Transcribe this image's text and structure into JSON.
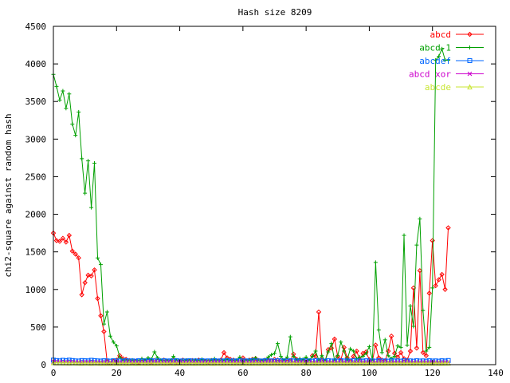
{
  "chart_data": {
    "type": "line",
    "title": "Hash size 8209",
    "xlabel": "",
    "ylabel": "chi2-square against random hash",
    "xlim": [
      0,
      140
    ],
    "ylim": [
      0,
      4500
    ],
    "xticks": [
      0,
      20,
      40,
      60,
      80,
      100,
      120,
      140
    ],
    "yticks": [
      0,
      500,
      1000,
      1500,
      2000,
      2500,
      3000,
      3500,
      4000,
      4500
    ],
    "grid": false,
    "legend_position": "top-right",
    "series": [
      {
        "name": "abcd",
        "color": "#ff0000",
        "marker": "diamond",
        "x": [
          0,
          1,
          2,
          3,
          4,
          5,
          6,
          7,
          8,
          9,
          10,
          11,
          12,
          13,
          14,
          15,
          16,
          17,
          18,
          19,
          20,
          21,
          22,
          23,
          24,
          25,
          26,
          27,
          28,
          29,
          30,
          31,
          32,
          33,
          34,
          35,
          36,
          37,
          38,
          39,
          40,
          41,
          42,
          43,
          44,
          45,
          46,
          47,
          48,
          49,
          50,
          51,
          52,
          53,
          54,
          55,
          56,
          57,
          58,
          59,
          60,
          61,
          62,
          63,
          64,
          65,
          66,
          67,
          68,
          69,
          70,
          71,
          72,
          73,
          74,
          75,
          76,
          77,
          78,
          79,
          80,
          81,
          82,
          83,
          84,
          85,
          86,
          87,
          88,
          89,
          90,
          91,
          92,
          93,
          94,
          95,
          96,
          97,
          98,
          99,
          100,
          101,
          102,
          103,
          104,
          105,
          106,
          107,
          108,
          109,
          110,
          111,
          112,
          113,
          114,
          115,
          116,
          117,
          118,
          119,
          120,
          121,
          122,
          123,
          124,
          125
        ],
        "y": [
          1750,
          1650,
          1640,
          1680,
          1630,
          1720,
          1510,
          1470,
          1420,
          930,
          1090,
          1190,
          1180,
          1260,
          880,
          650,
          440,
          40,
          20,
          45,
          60,
          120,
          80,
          70,
          55,
          40,
          45,
          35,
          60,
          50,
          45,
          40,
          55,
          50,
          45,
          60,
          45,
          40,
          55,
          40,
          45,
          60,
          50,
          45,
          55,
          45,
          60,
          50,
          45,
          40,
          55,
          45,
          50,
          60,
          160,
          90,
          70,
          60,
          45,
          55,
          90,
          50,
          60,
          70,
          80,
          55,
          45,
          60,
          65,
          50,
          70,
          60,
          55,
          45,
          60,
          50,
          140,
          70,
          55,
          45,
          60,
          50,
          120,
          110,
          700,
          60,
          45,
          200,
          220,
          340,
          110,
          60,
          230,
          90,
          50,
          110,
          180,
          60,
          150,
          170,
          65,
          55,
          260,
          90,
          60,
          50,
          180,
          380,
          150,
          100,
          160,
          80,
          60,
          180,
          1020,
          220,
          1250,
          160,
          120,
          950,
          1650,
          1050,
          1130,
          1200,
          1000,
          1820
        ]
      },
      {
        "name": "abcd-1",
        "color": "#00a000",
        "marker": "plus",
        "x": [
          0,
          1,
          2,
          3,
          4,
          5,
          6,
          7,
          8,
          9,
          10,
          11,
          12,
          13,
          14,
          15,
          16,
          17,
          18,
          19,
          20,
          21,
          22,
          23,
          24,
          25,
          26,
          27,
          28,
          29,
          30,
          31,
          32,
          33,
          34,
          35,
          36,
          37,
          38,
          39,
          40,
          41,
          42,
          43,
          44,
          45,
          46,
          47,
          48,
          49,
          50,
          51,
          52,
          53,
          54,
          55,
          56,
          57,
          58,
          59,
          60,
          61,
          62,
          63,
          64,
          65,
          66,
          67,
          68,
          69,
          70,
          71,
          72,
          73,
          74,
          75,
          76,
          77,
          78,
          79,
          80,
          81,
          82,
          83,
          84,
          85,
          86,
          87,
          88,
          89,
          90,
          91,
          92,
          93,
          94,
          95,
          96,
          97,
          98,
          99,
          100,
          101,
          102,
          103,
          104,
          105,
          106,
          107,
          108,
          109,
          110,
          111,
          112,
          113,
          114,
          115,
          116,
          117,
          118,
          119,
          120,
          121,
          122,
          123,
          124,
          125
        ],
        "y": [
          3860,
          3700,
          3520,
          3640,
          3410,
          3600,
          3200,
          3050,
          3360,
          2740,
          2280,
          2710,
          2090,
          2680,
          1420,
          1330,
          540,
          700,
          380,
          300,
          250,
          100,
          60,
          50,
          45,
          60,
          40,
          55,
          80,
          60,
          90,
          70,
          170,
          90,
          60,
          45,
          55,
          50,
          110,
          60,
          45,
          55,
          60,
          50,
          45,
          60,
          55,
          70,
          50,
          45,
          60,
          80,
          50,
          45,
          60,
          70,
          55,
          50,
          60,
          100,
          45,
          55,
          60,
          70,
          90,
          50,
          55,
          60,
          100,
          130,
          150,
          280,
          110,
          60,
          100,
          370,
          110,
          60,
          80,
          70,
          100,
          60,
          110,
          180,
          60,
          120,
          50,
          170,
          280,
          60,
          120,
          300,
          180,
          60,
          210,
          180,
          80,
          100,
          110,
          150,
          240,
          60,
          1360,
          460,
          160,
          330,
          120,
          80,
          110,
          250,
          230,
          1720,
          260,
          780,
          510,
          1590,
          1940,
          720,
          180,
          230,
          1020,
          4050,
          4100,
          4200,
          4050,
          4050
        ]
      },
      {
        "name": "abcdef",
        "color": "#0066ff",
        "marker": "square",
        "x": [
          0,
          1,
          2,
          3,
          4,
          5,
          6,
          7,
          8,
          9,
          10,
          11,
          12,
          13,
          14,
          15,
          16,
          17,
          18,
          19,
          20,
          21,
          22,
          23,
          24,
          25,
          26,
          27,
          28,
          29,
          30,
          31,
          32,
          33,
          34,
          35,
          36,
          37,
          38,
          39,
          40,
          41,
          42,
          43,
          44,
          45,
          46,
          47,
          48,
          49,
          50,
          51,
          52,
          53,
          54,
          55,
          56,
          57,
          58,
          59,
          60,
          61,
          62,
          63,
          64,
          65,
          66,
          67,
          68,
          69,
          70,
          71,
          72,
          73,
          74,
          75,
          76,
          77,
          78,
          79,
          80,
          81,
          82,
          83,
          84,
          85,
          86,
          87,
          88,
          89,
          90,
          91,
          92,
          93,
          94,
          95,
          96,
          97,
          98,
          99,
          100,
          101,
          102,
          103,
          104,
          105,
          106,
          107,
          108,
          109,
          110,
          111,
          112,
          113,
          114,
          115,
          116,
          117,
          118,
          119,
          120,
          121,
          122,
          123,
          124,
          125
        ],
        "y": [
          60,
          55,
          50,
          58,
          52,
          60,
          55,
          50,
          48,
          55,
          52,
          50,
          58,
          54,
          50,
          48,
          52,
          50,
          46,
          52,
          48,
          50,
          46,
          52,
          48,
          50,
          46,
          52,
          48,
          50,
          46,
          52,
          48,
          50,
          46,
          52,
          48,
          50,
          46,
          52,
          48,
          50,
          46,
          52,
          48,
          50,
          46,
          52,
          48,
          50,
          46,
          52,
          48,
          50,
          46,
          52,
          48,
          50,
          46,
          52,
          48,
          50,
          46,
          52,
          48,
          50,
          46,
          52,
          48,
          50,
          46,
          52,
          48,
          50,
          46,
          52,
          48,
          50,
          46,
          52,
          48,
          50,
          46,
          52,
          48,
          50,
          46,
          52,
          48,
          50,
          46,
          52,
          48,
          50,
          46,
          52,
          48,
          50,
          46,
          52,
          48,
          50,
          46,
          52,
          48,
          50,
          46,
          52,
          48,
          50,
          46,
          52,
          48,
          50,
          46,
          52,
          48,
          50,
          46,
          52,
          48,
          50,
          46,
          52,
          48,
          55
        ]
      },
      {
        "name": "abcd xor",
        "color": "#cc00cc",
        "marker": "x",
        "x": [
          0,
          1,
          2,
          3,
          4,
          5,
          6,
          7,
          8,
          9,
          10,
          11,
          12,
          13,
          14,
          15,
          16,
          17,
          18,
          19,
          20,
          21,
          22,
          23,
          24,
          25,
          26,
          27,
          28,
          29,
          30,
          31,
          32,
          33,
          34,
          35,
          36,
          37,
          38,
          39,
          40,
          41,
          42,
          43,
          44,
          45,
          46,
          47,
          48,
          49,
          50,
          51,
          52,
          53,
          54,
          55,
          56,
          57,
          58,
          59,
          60,
          61,
          62,
          63,
          64,
          65,
          66,
          67,
          68,
          69,
          70,
          71,
          72,
          73,
          74,
          75,
          76,
          77,
          78,
          79,
          80,
          81,
          82,
          83,
          84,
          85,
          86,
          87,
          88,
          89,
          90,
          91,
          92,
          93,
          94,
          95,
          96,
          97,
          98,
          99,
          100,
          101,
          102,
          103,
          104,
          105,
          106,
          107,
          108,
          109,
          110,
          111,
          112,
          113,
          114,
          115,
          116,
          117,
          118,
          119,
          120,
          121,
          122,
          123,
          124,
          125
        ],
        "y": [
          40,
          35,
          38,
          34,
          36,
          33,
          35,
          32,
          34,
          30,
          33,
          31,
          34,
          30,
          32,
          30,
          28,
          32,
          30,
          28,
          31,
          29,
          30,
          28,
          31,
          29,
          30,
          28,
          31,
          29,
          30,
          28,
          31,
          29,
          30,
          28,
          31,
          29,
          30,
          28,
          31,
          29,
          30,
          28,
          31,
          29,
          30,
          28,
          31,
          29,
          30,
          28,
          31,
          29,
          30,
          28,
          31,
          29,
          30,
          28,
          31,
          29,
          30,
          28,
          31,
          29,
          30,
          28,
          31,
          29,
          30,
          28,
          31,
          29,
          30,
          28,
          31,
          29,
          30,
          28,
          31,
          29,
          30,
          28,
          31,
          29,
          30,
          28,
          31,
          29,
          30,
          28,
          31,
          29,
          30,
          28,
          31,
          29,
          30,
          28,
          31,
          29,
          30,
          28,
          31,
          29,
          30,
          28,
          31,
          29,
          30,
          28,
          31,
          29,
          30,
          28,
          31,
          29,
          30,
          28,
          31,
          29,
          30,
          28,
          31,
          30
        ]
      },
      {
        "name": "abcde",
        "color": "#c8e632",
        "marker": "triangle",
        "x": [
          0,
          1,
          2,
          3,
          4,
          5,
          6,
          7,
          8,
          9,
          10,
          11,
          12,
          13,
          14,
          15,
          16,
          17,
          18,
          19,
          20,
          21,
          22,
          23,
          24,
          25,
          26,
          27,
          28,
          29,
          30,
          31,
          32,
          33,
          34,
          35,
          36,
          37,
          38,
          39,
          40,
          41,
          42,
          43,
          44,
          45,
          46,
          47,
          48,
          49,
          50,
          51,
          52,
          53,
          54,
          55,
          56,
          57,
          58,
          59,
          60,
          61,
          62,
          63,
          64,
          65,
          66,
          67,
          68,
          69,
          70,
          71,
          72,
          73,
          74,
          75,
          76,
          77,
          78,
          79,
          80,
          81,
          82,
          83,
          84,
          85,
          86,
          87,
          88,
          89,
          90,
          91,
          92,
          93,
          94,
          95,
          96,
          97,
          98,
          99,
          100,
          101,
          102,
          103,
          104,
          105,
          106,
          107,
          108,
          109,
          110,
          111,
          112,
          113,
          114,
          115,
          116,
          117,
          118,
          119,
          120,
          121,
          122,
          123,
          124,
          125
        ],
        "y": [
          25,
          22,
          24,
          21,
          23,
          20,
          22,
          21,
          20,
          19,
          21,
          20,
          19,
          21,
          20,
          18,
          20,
          19,
          18,
          20,
          19,
          18,
          20,
          19,
          18,
          20,
          19,
          18,
          20,
          19,
          18,
          20,
          19,
          18,
          20,
          19,
          18,
          20,
          19,
          18,
          20,
          19,
          18,
          20,
          19,
          18,
          20,
          19,
          18,
          20,
          19,
          18,
          20,
          19,
          18,
          20,
          19,
          18,
          20,
          19,
          18,
          20,
          19,
          18,
          20,
          19,
          18,
          20,
          19,
          18,
          20,
          19,
          18,
          20,
          19,
          18,
          20,
          19,
          18,
          20,
          19,
          18,
          20,
          19,
          18,
          20,
          19,
          18,
          20,
          19,
          18,
          20,
          19,
          18,
          20,
          19,
          18,
          20,
          19,
          18,
          20,
          19,
          18,
          20,
          19,
          18,
          20,
          19,
          18,
          20,
          19,
          18,
          20,
          19,
          18,
          20,
          19,
          18,
          20,
          19,
          18,
          20,
          19,
          18,
          20,
          20
        ]
      }
    ]
  }
}
